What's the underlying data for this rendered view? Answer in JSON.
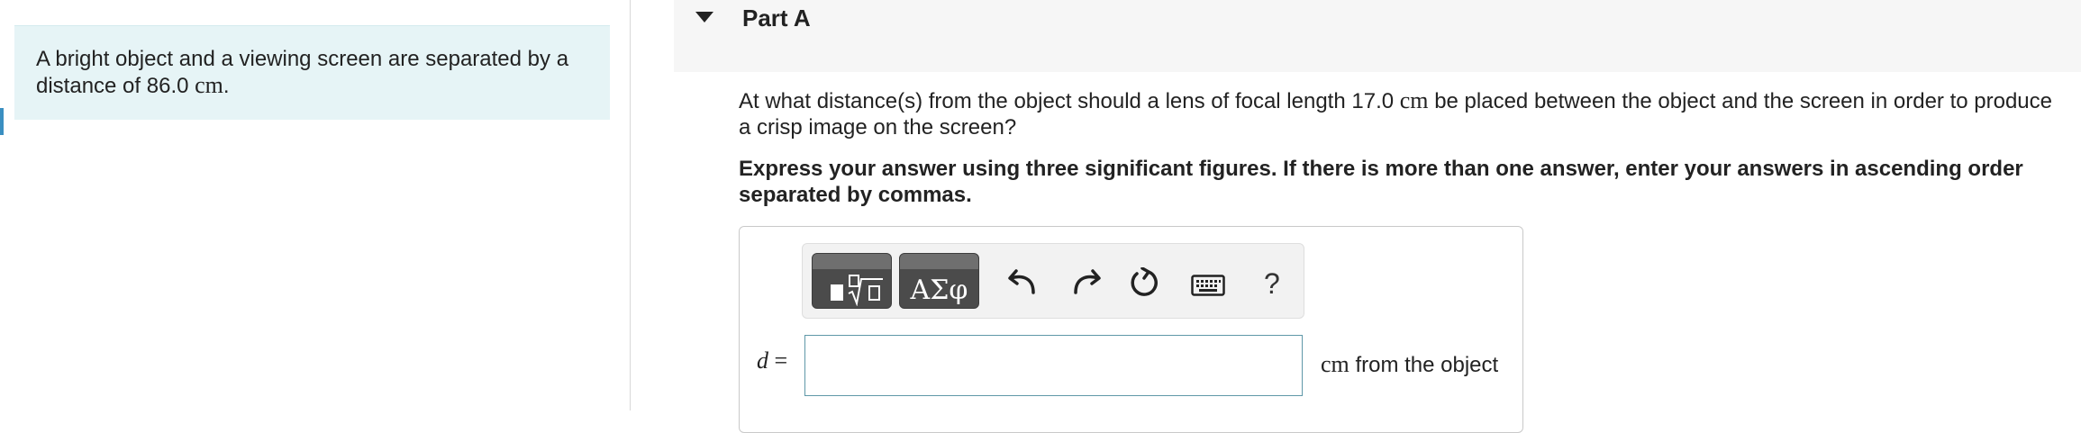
{
  "intro": {
    "text": "A bright object and a viewing screen are separated by a distance of 86.0",
    "unit": "cm",
    "trailing": "."
  },
  "part": {
    "title": "Part A",
    "collapse_icon": "caret-down-icon"
  },
  "question": {
    "text_before": "At what distance(s) from the object should a lens of focal length 17.0",
    "unit": "cm",
    "text_after": "be placed between the object and the screen in order to produce a crisp image on the screen?"
  },
  "instruction": "Express your answer using three significant figures. If there is more than one answer, enter your answers in ascending order separated by commas.",
  "toolbar": {
    "templates_icon": "math-templates-icon",
    "greek_label": "ΑΣφ",
    "undo_icon": "undo-icon",
    "redo_icon": "redo-icon",
    "reset_icon": "reset-icon",
    "keyboard_icon": "keyboard-icon",
    "help_label": "?"
  },
  "answer": {
    "variable": "d",
    "equals": "=",
    "value": "",
    "unit": "cm",
    "suffix": "from the object"
  },
  "colors": {
    "intro_bg": "#e6f4f6",
    "header_bg": "#f6f6f6",
    "input_border": "#5f98a8",
    "button_dark": "#4b4b4b"
  }
}
